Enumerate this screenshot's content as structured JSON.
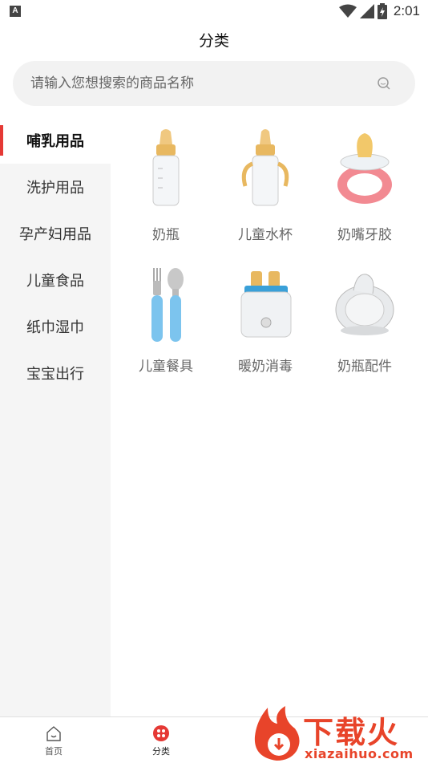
{
  "status_bar": {
    "left_glyph": "A",
    "time": "2:01"
  },
  "header": {
    "title": "分类"
  },
  "search": {
    "placeholder": "请输入您想搜索的商品名称"
  },
  "sidebar": {
    "items": [
      {
        "label": "哺乳用品",
        "active": true
      },
      {
        "label": "洗护用品",
        "active": false
      },
      {
        "label": "孕产妇用品",
        "active": false
      },
      {
        "label": "儿童食品",
        "active": false
      },
      {
        "label": "纸巾湿巾",
        "active": false
      },
      {
        "label": "宝宝出行",
        "active": false
      }
    ]
  },
  "categories": [
    {
      "label": "奶瓶",
      "icon": "baby-bottle-icon"
    },
    {
      "label": "儿童水杯",
      "icon": "sippy-cup-icon"
    },
    {
      "label": "奶嘴牙胶",
      "icon": "pacifier-icon"
    },
    {
      "label": "儿童餐具",
      "icon": "baby-utensils-icon"
    },
    {
      "label": "暖奶消毒",
      "icon": "bottle-warmer-icon"
    },
    {
      "label": "奶瓶配件",
      "icon": "nipple-icon"
    }
  ],
  "tabbar": {
    "items": [
      {
        "label": "首页",
        "icon": "home-icon"
      },
      {
        "label": "分类",
        "icon": "category-icon",
        "active": true
      }
    ]
  },
  "watermark": {
    "text": "下载火",
    "url": "xiazaihuo.com"
  },
  "colors": {
    "accent": "#e53935",
    "watermark": "#e8442a",
    "sidebar_bg": "#f5f5f5"
  }
}
